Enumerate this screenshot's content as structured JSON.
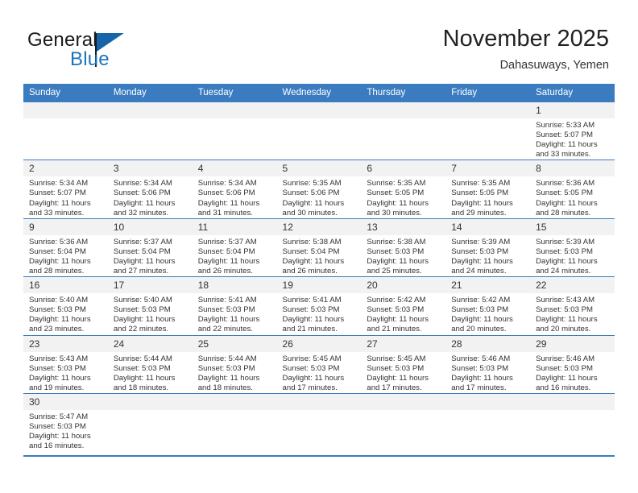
{
  "brand": {
    "name_part1": "General",
    "name_part2": "Blue",
    "color_dark": "#1a1a1a",
    "color_blue": "#1c73b8"
  },
  "header": {
    "title": "November 2025",
    "subtitle": "Dahasuways, Yemen"
  },
  "theme": {
    "header_row_bg": "#3b7cc0",
    "day_number_bg": "#f2f2f2",
    "rule_color": "#3b7cc0"
  },
  "weekday_headers": [
    "Sunday",
    "Monday",
    "Tuesday",
    "Wednesday",
    "Thursday",
    "Friday",
    "Saturday"
  ],
  "weeks": [
    [
      {
        "day": "",
        "empty": true
      },
      {
        "day": "",
        "empty": true
      },
      {
        "day": "",
        "empty": true
      },
      {
        "day": "",
        "empty": true
      },
      {
        "day": "",
        "empty": true
      },
      {
        "day": "",
        "empty": true
      },
      {
        "day": "1",
        "sunrise": "Sunrise: 5:33 AM",
        "sunset": "Sunset: 5:07 PM",
        "daylight": "Daylight: 11 hours and 33 minutes."
      }
    ],
    [
      {
        "day": "2",
        "sunrise": "Sunrise: 5:34 AM",
        "sunset": "Sunset: 5:07 PM",
        "daylight": "Daylight: 11 hours and 33 minutes."
      },
      {
        "day": "3",
        "sunrise": "Sunrise: 5:34 AM",
        "sunset": "Sunset: 5:06 PM",
        "daylight": "Daylight: 11 hours and 32 minutes."
      },
      {
        "day": "4",
        "sunrise": "Sunrise: 5:34 AM",
        "sunset": "Sunset: 5:06 PM",
        "daylight": "Daylight: 11 hours and 31 minutes."
      },
      {
        "day": "5",
        "sunrise": "Sunrise: 5:35 AM",
        "sunset": "Sunset: 5:06 PM",
        "daylight": "Daylight: 11 hours and 30 minutes."
      },
      {
        "day": "6",
        "sunrise": "Sunrise: 5:35 AM",
        "sunset": "Sunset: 5:05 PM",
        "daylight": "Daylight: 11 hours and 30 minutes."
      },
      {
        "day": "7",
        "sunrise": "Sunrise: 5:35 AM",
        "sunset": "Sunset: 5:05 PM",
        "daylight": "Daylight: 11 hours and 29 minutes."
      },
      {
        "day": "8",
        "sunrise": "Sunrise: 5:36 AM",
        "sunset": "Sunset: 5:05 PM",
        "daylight": "Daylight: 11 hours and 28 minutes."
      }
    ],
    [
      {
        "day": "9",
        "sunrise": "Sunrise: 5:36 AM",
        "sunset": "Sunset: 5:04 PM",
        "daylight": "Daylight: 11 hours and 28 minutes."
      },
      {
        "day": "10",
        "sunrise": "Sunrise: 5:37 AM",
        "sunset": "Sunset: 5:04 PM",
        "daylight": "Daylight: 11 hours and 27 minutes."
      },
      {
        "day": "11",
        "sunrise": "Sunrise: 5:37 AM",
        "sunset": "Sunset: 5:04 PM",
        "daylight": "Daylight: 11 hours and 26 minutes."
      },
      {
        "day": "12",
        "sunrise": "Sunrise: 5:38 AM",
        "sunset": "Sunset: 5:04 PM",
        "daylight": "Daylight: 11 hours and 26 minutes."
      },
      {
        "day": "13",
        "sunrise": "Sunrise: 5:38 AM",
        "sunset": "Sunset: 5:03 PM",
        "daylight": "Daylight: 11 hours and 25 minutes."
      },
      {
        "day": "14",
        "sunrise": "Sunrise: 5:39 AM",
        "sunset": "Sunset: 5:03 PM",
        "daylight": "Daylight: 11 hours and 24 minutes."
      },
      {
        "day": "15",
        "sunrise": "Sunrise: 5:39 AM",
        "sunset": "Sunset: 5:03 PM",
        "daylight": "Daylight: 11 hours and 24 minutes."
      }
    ],
    [
      {
        "day": "16",
        "sunrise": "Sunrise: 5:40 AM",
        "sunset": "Sunset: 5:03 PM",
        "daylight": "Daylight: 11 hours and 23 minutes."
      },
      {
        "day": "17",
        "sunrise": "Sunrise: 5:40 AM",
        "sunset": "Sunset: 5:03 PM",
        "daylight": "Daylight: 11 hours and 22 minutes."
      },
      {
        "day": "18",
        "sunrise": "Sunrise: 5:41 AM",
        "sunset": "Sunset: 5:03 PM",
        "daylight": "Daylight: 11 hours and 22 minutes."
      },
      {
        "day": "19",
        "sunrise": "Sunrise: 5:41 AM",
        "sunset": "Sunset: 5:03 PM",
        "daylight": "Daylight: 11 hours and 21 minutes."
      },
      {
        "day": "20",
        "sunrise": "Sunrise: 5:42 AM",
        "sunset": "Sunset: 5:03 PM",
        "daylight": "Daylight: 11 hours and 21 minutes."
      },
      {
        "day": "21",
        "sunrise": "Sunrise: 5:42 AM",
        "sunset": "Sunset: 5:03 PM",
        "daylight": "Daylight: 11 hours and 20 minutes."
      },
      {
        "day": "22",
        "sunrise": "Sunrise: 5:43 AM",
        "sunset": "Sunset: 5:03 PM",
        "daylight": "Daylight: 11 hours and 20 minutes."
      }
    ],
    [
      {
        "day": "23",
        "sunrise": "Sunrise: 5:43 AM",
        "sunset": "Sunset: 5:03 PM",
        "daylight": "Daylight: 11 hours and 19 minutes."
      },
      {
        "day": "24",
        "sunrise": "Sunrise: 5:44 AM",
        "sunset": "Sunset: 5:03 PM",
        "daylight": "Daylight: 11 hours and 18 minutes."
      },
      {
        "day": "25",
        "sunrise": "Sunrise: 5:44 AM",
        "sunset": "Sunset: 5:03 PM",
        "daylight": "Daylight: 11 hours and 18 minutes."
      },
      {
        "day": "26",
        "sunrise": "Sunrise: 5:45 AM",
        "sunset": "Sunset: 5:03 PM",
        "daylight": "Daylight: 11 hours and 17 minutes."
      },
      {
        "day": "27",
        "sunrise": "Sunrise: 5:45 AM",
        "sunset": "Sunset: 5:03 PM",
        "daylight": "Daylight: 11 hours and 17 minutes."
      },
      {
        "day": "28",
        "sunrise": "Sunrise: 5:46 AM",
        "sunset": "Sunset: 5:03 PM",
        "daylight": "Daylight: 11 hours and 17 minutes."
      },
      {
        "day": "29",
        "sunrise": "Sunrise: 5:46 AM",
        "sunset": "Sunset: 5:03 PM",
        "daylight": "Daylight: 11 hours and 16 minutes."
      }
    ],
    [
      {
        "day": "30",
        "sunrise": "Sunrise: 5:47 AM",
        "sunset": "Sunset: 5:03 PM",
        "daylight": "Daylight: 11 hours and 16 minutes."
      },
      {
        "day": "",
        "empty": true
      },
      {
        "day": "",
        "empty": true
      },
      {
        "day": "",
        "empty": true
      },
      {
        "day": "",
        "empty": true
      },
      {
        "day": "",
        "empty": true
      },
      {
        "day": "",
        "empty": true
      }
    ]
  ]
}
